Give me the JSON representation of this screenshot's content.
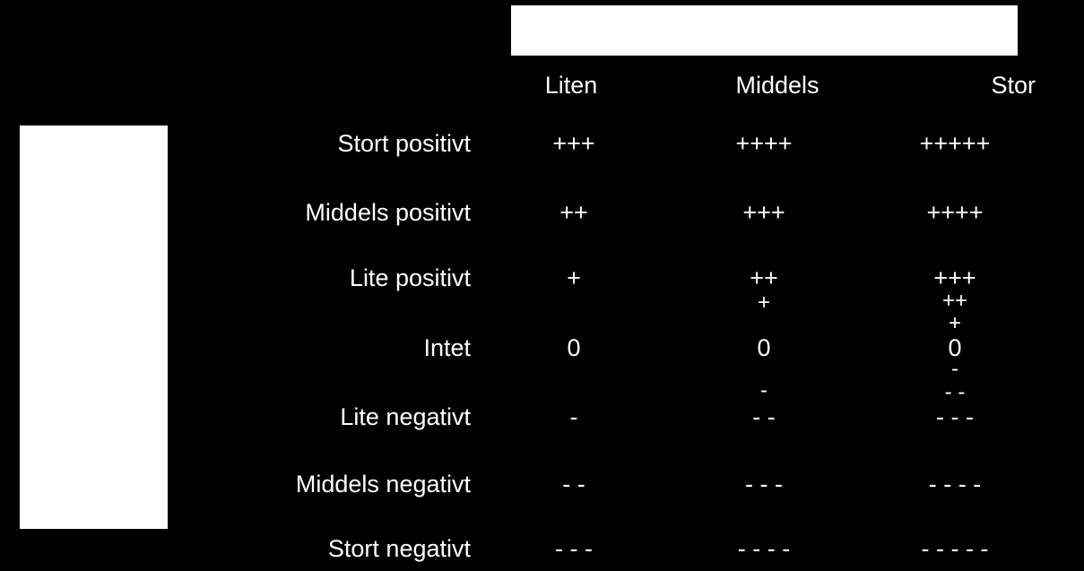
{
  "headers": {
    "liten": "Liten",
    "middels": "Middels",
    "stor": "Stor"
  },
  "row_labels": {
    "r1": "Stort positivt",
    "r2": "Middels positivt",
    "r3": "Lite positivt",
    "r4": "Intet",
    "r5": "Lite negativt",
    "r6": "Middels negativt",
    "r7": "Stort negativt"
  },
  "cells": {
    "r1": {
      "liten": "+++",
      "middels": "++++",
      "stor": "+++++"
    },
    "r2": {
      "liten": "++",
      "middels": "+++",
      "stor": "++++"
    },
    "r3": {
      "liten": "+",
      "middels": "++",
      "stor": "+++"
    },
    "r4": {
      "liten": "0",
      "middels": "0",
      "stor": "0"
    },
    "r5": {
      "liten": "-",
      "middels": "- -",
      "stor": "- - -"
    },
    "r6": {
      "liten": "- -",
      "middels": "- - -",
      "stor": "- - - -"
    },
    "r7": {
      "liten": "- - -",
      "middels": "- - - -",
      "stor": "- - - - -"
    }
  },
  "extras": {
    "mid_between_r3_r4": "+",
    "mid_above_r5_a": "-",
    "mid_r5_secondary": "- -",
    "stor_between_r3_r4_a": "++",
    "stor_between_r3_r4_b": "+",
    "stor_between_r4_r5_a": "-",
    "stor_between_r4_r5_b": "- -",
    "stor_r5_secondary": "- - -"
  },
  "chart_data": {
    "type": "table",
    "title": "",
    "columns": [
      "Liten",
      "Middels",
      "Stor"
    ],
    "rows": [
      "Stort positivt",
      "Middels positivt",
      "Lite positivt",
      "Intet",
      "Lite negativt",
      "Middels negativt",
      "Stort negativt"
    ],
    "values": [
      [
        "+++",
        "++++",
        "+++++"
      ],
      [
        "++",
        "+++",
        "++++"
      ],
      [
        "+",
        "++",
        "+++"
      ],
      [
        "0",
        "0",
        "0"
      ],
      [
        "-",
        "- -",
        "- - -"
      ],
      [
        "- -",
        "- - -",
        "- - - -"
      ],
      [
        "- - -",
        "- - - -",
        "- - - - -"
      ]
    ],
    "overlays": {
      "middels_column_extra": [
        "+",
        "-",
        "- -"
      ],
      "stor_column_extra": [
        "++",
        "+",
        "-",
        "- -",
        "- - -"
      ]
    }
  }
}
